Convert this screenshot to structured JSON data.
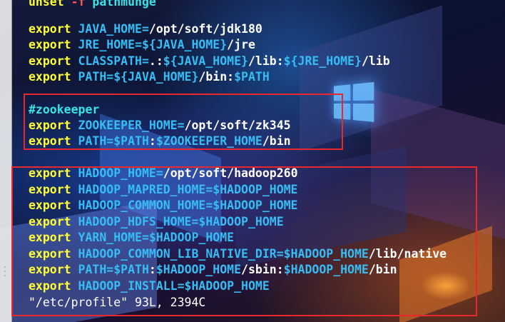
{
  "colors": {
    "keyword": "#ffff33",
    "variable": "#36bdf5",
    "text": "#ffffff",
    "comment": "#36e6e6",
    "highlight_box": "#e8282d"
  },
  "editor": {
    "lines": {
      "l0": {
        "kw": "unset",
        "rest": " -f ",
        "name": "pathmunge"
      },
      "l1": {
        "kw": "export",
        "var": "JAVA_HOME=",
        "rest": "/opt/soft/jdk180"
      },
      "l2": {
        "kw": "export",
        "var": "JRE_HOME=${JAVA_HOME}",
        "rest": "/jre"
      },
      "l3": {
        "kw": "export",
        "var": "CLASSPATH=",
        "a": ".:",
        "b": "${JAVA_HOME}",
        "c": "/lib:",
        "d": "${JRE_HOME}",
        "e": "/lib"
      },
      "l4": {
        "kw": "export",
        "var": "PATH=${JAVA_HOME}",
        "a": "/bin:",
        "b": "$PATH"
      },
      "l5": {
        "comment": "#zookeeper"
      },
      "l6": {
        "kw": "export",
        "var": "ZOOKEEPER_HOME=",
        "rest": "/opt/soft/zk345"
      },
      "l7": {
        "kw": "export",
        "var": "PATH=$PATH",
        "a": ":",
        "b": "$ZOOKEEPER_HOME",
        "c": "/bin"
      },
      "l8": {
        "kw": "export",
        "var": "HADOOP_HOME=",
        "rest": "/opt/soft/hadoop260"
      },
      "l9": {
        "kw": "export",
        "var": "HADOOP_MAPRED_HOME=$HADOOP_HOME"
      },
      "l10": {
        "kw": "export",
        "var": "HADOOP_COMMON_HOME=$HADOOP_HOME"
      },
      "l11": {
        "kw": "export",
        "var": "HADOOP_HDFS_HOME=$HADOOP_HOME"
      },
      "l12": {
        "kw": "export",
        "var": "YARN_HOME=$HADOOP_HOME"
      },
      "l13": {
        "kw": "export",
        "var": "HADOOP_COMMON_LIB_NATIVE_DIR=$HADOOP_HOME",
        "rest": "/lib/native"
      },
      "l14": {
        "kw": "export",
        "var": "PATH=$PATH",
        "a": ":",
        "b": "$HADOOP_HOME",
        "c": "/sbin:",
        "d": "$HADOOP_HOME",
        "e": "/bin"
      },
      "l15": {
        "kw": "export",
        "var": "HADOOP_INSTALL=$HADOOP_HOME"
      }
    },
    "status_line": "\"/etc/profile\" 93L, 2394C"
  }
}
